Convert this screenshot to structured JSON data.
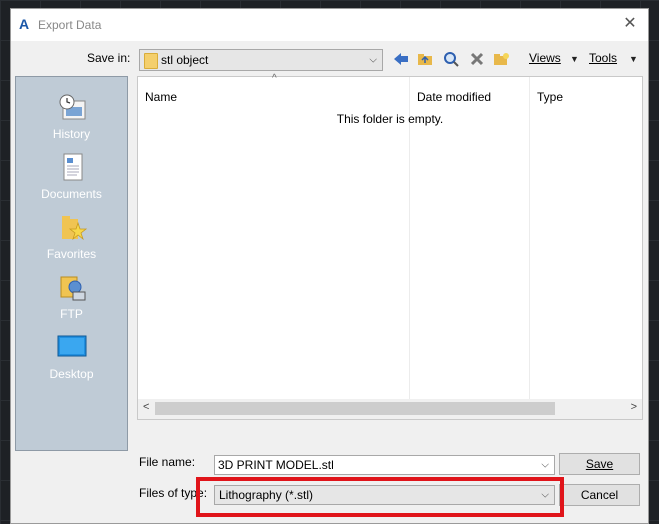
{
  "window": {
    "title": "Export Data"
  },
  "toolbar": {
    "save_in_label": "Save in:",
    "save_in_value": "stl object",
    "views_label": "Views",
    "tools_label": "Tools"
  },
  "places": [
    {
      "label": "History",
      "icon": "history-icon"
    },
    {
      "label": "Documents",
      "icon": "documents-icon"
    },
    {
      "label": "Favorites",
      "icon": "favorites-icon"
    },
    {
      "label": "FTP",
      "icon": "ftp-icon"
    },
    {
      "label": "Desktop",
      "icon": "desktop-icon"
    }
  ],
  "file_list": {
    "columns": [
      "Name",
      "Date modified",
      "Type"
    ],
    "empty_message": "This folder is empty."
  },
  "form": {
    "file_name_label": "File name:",
    "file_name_value": "3D PRINT MODEL.stl",
    "file_type_label": "Files of type:",
    "file_type_value": "Lithography (*.stl)",
    "save_label": "Save",
    "cancel_label": "Cancel"
  },
  "colors": {
    "highlight": "#e0141a",
    "places_bg": "#bfcbd6"
  }
}
